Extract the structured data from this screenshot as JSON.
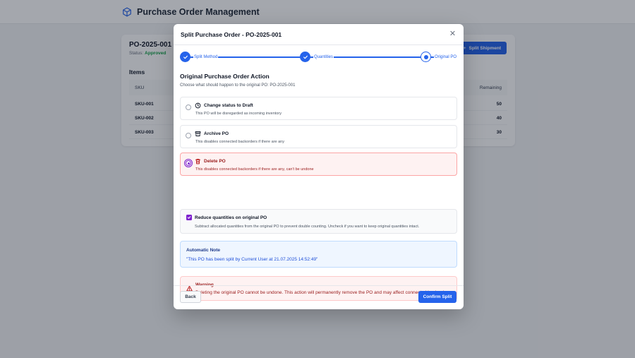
{
  "app": {
    "title": "Purchase Order Management",
    "icon": "cube-icon"
  },
  "background": {
    "po_number": "PO-2025-001",
    "status_label": "Status:",
    "status_value": "Approved",
    "split_button": "Split Shipment",
    "items_title": "Items",
    "columns": {
      "sku": "SKU",
      "remaining": "Remaining"
    },
    "rows": [
      {
        "sku": "SKU-001",
        "remaining": "50"
      },
      {
        "sku": "SKU-002",
        "remaining": "40"
      },
      {
        "sku": "SKU-003",
        "remaining": "30"
      }
    ]
  },
  "modal": {
    "title": "Split Purchase Order - PO-2025-001",
    "close_icon": "close-icon",
    "steps": [
      {
        "label": "Split Method",
        "state": "done"
      },
      {
        "label": "Quantities",
        "state": "done"
      },
      {
        "label": "Original PO",
        "state": "current"
      }
    ],
    "section_title": "Original Purchase Order Action",
    "section_desc": "Choose what should happen to the original PO: PO-2025-001",
    "options": [
      {
        "title": "Change status to Draft",
        "desc": "This PO will be disregarded as incoming inventory",
        "icon": "clock-icon",
        "selected": false
      },
      {
        "title": "Archive PO",
        "desc": "This disables connected backorders if there are any",
        "icon": "archive-icon",
        "selected": false
      },
      {
        "title": "Delete PO",
        "desc": "This disables connected backorders if there are any, can't be undone",
        "icon": "trash-icon",
        "selected": true
      }
    ],
    "reduce": {
      "checked": true,
      "title": "Reduce quantities on original PO",
      "desc": "Subtract allocated quantities from the original PO to prevent double counting. Uncheck if you want to keep original quantities intact."
    },
    "note": {
      "title": "Automatic Note",
      "text": "\"This PO has been split by Current User at 21.07.2025 14:52:49\""
    },
    "warning": {
      "title": "Warning",
      "text": "Deleting the original PO cannot be undone. This action will permanently remove the PO and may affect connected backorders.",
      "icon": "warning-triangle-icon"
    },
    "back_button": "Back",
    "confirm_button": "Confirm Split"
  },
  "colors": {
    "primary": "#2563eb",
    "danger": "#991b1b",
    "accent_purple": "#7e22ce",
    "success": "#16a34a"
  }
}
